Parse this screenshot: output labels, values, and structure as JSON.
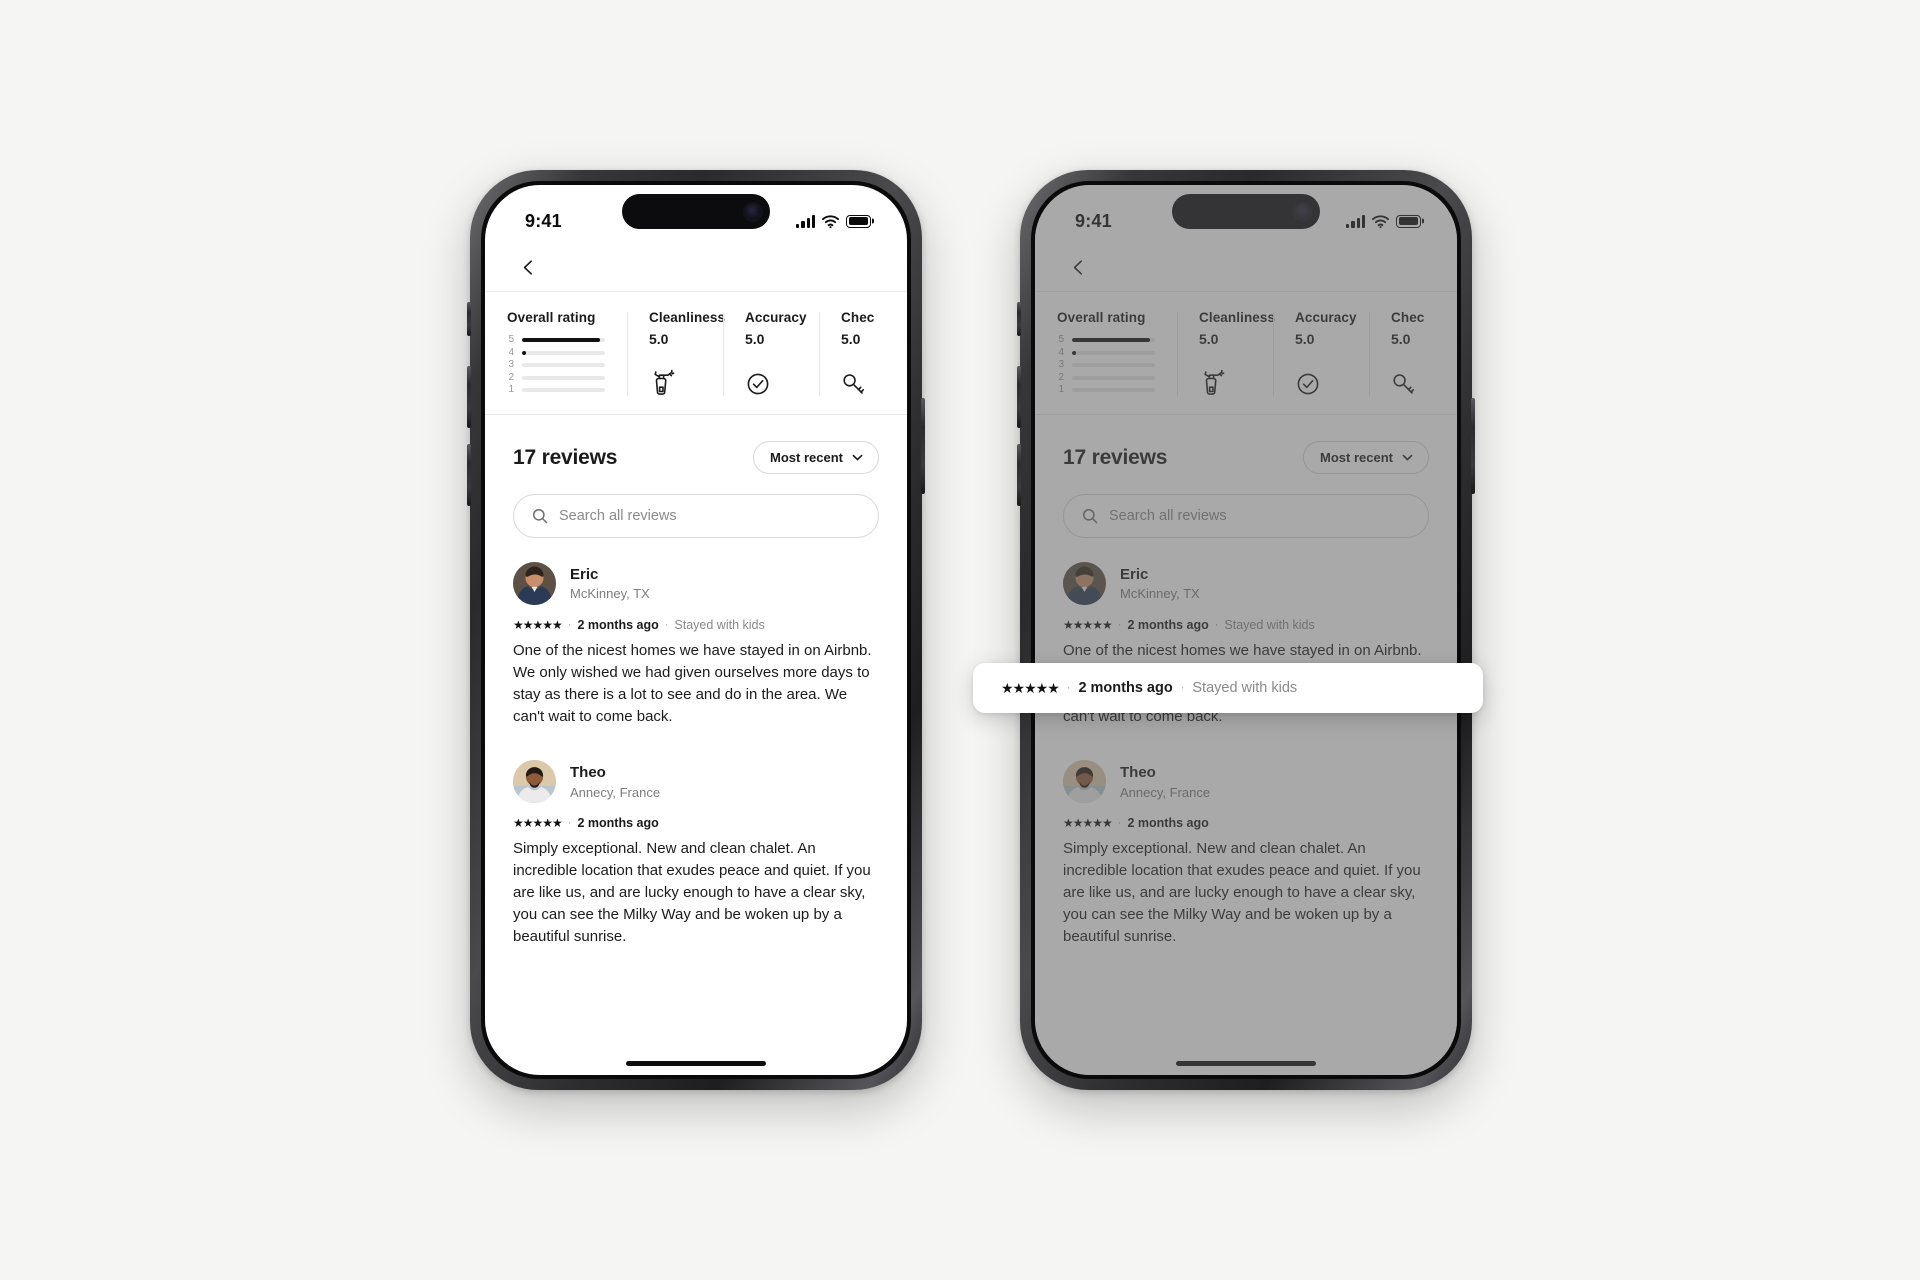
{
  "canvas": {
    "background": "#f5f5f4"
  },
  "status_bar": {
    "time": "9:41",
    "icons": [
      "signal-bars-icon",
      "wifi-icon",
      "battery-icon"
    ]
  },
  "nav": {
    "back_label": "‹",
    "back_icon": "chevron-left-icon"
  },
  "ratings": {
    "overall": {
      "title": "Overall rating",
      "rows": [
        {
          "label": "5",
          "pct": 94
        },
        {
          "label": "4",
          "pct": 3
        },
        {
          "label": "3",
          "pct": 0
        },
        {
          "label": "2",
          "pct": 0
        },
        {
          "label": "1",
          "pct": 0
        }
      ]
    },
    "categories": [
      {
        "title": "Cleanliness",
        "value": "5.0",
        "icon": "spray-bottle-icon"
      },
      {
        "title": "Accuracy",
        "value": "5.0",
        "icon": "check-circle-icon"
      },
      {
        "title": "Chec",
        "value": "5.0",
        "icon": "key-icon"
      }
    ]
  },
  "reviews_header": {
    "count_label": "17 reviews",
    "sort_label": "Most recent",
    "sort_icon": "chevron-down-icon"
  },
  "search": {
    "placeholder": "Search all reviews",
    "value": "",
    "icon": "search-icon"
  },
  "reviews": [
    {
      "name": "Eric",
      "location": "McKinney, TX",
      "stars": "★★★★★",
      "rating": 5,
      "time": "2 months ago",
      "tag": "Stayed with kids",
      "body": "One of the nicest homes we have stayed in on Airbnb. We only wished we had given ourselves more days to stay as there is a lot to see and do in the area. We can't wait to come back."
    },
    {
      "name": "Theo",
      "location": "Annecy, France",
      "stars": "★★★★★",
      "rating": 5,
      "time": "2 months ago",
      "tag": "",
      "body": "Simply exceptional. New and clean chalet. An incredible location that exudes peace and quiet. If you are like us, and are lucky enough to have a clear sky, you can see the Milky Way and be woken up by a beautiful sunrise."
    }
  ],
  "highlight_card": {
    "stars": "★★★★★",
    "time": "2 months ago",
    "tag": "Stayed with kids",
    "separator": "·"
  },
  "separator": "·",
  "colors": {
    "accent": "#111111",
    "muted": "#8a8a8a",
    "border": "#d8d8d8",
    "track": "#e9e9e9",
    "scrim": "rgba(90,90,90,0.52)"
  }
}
